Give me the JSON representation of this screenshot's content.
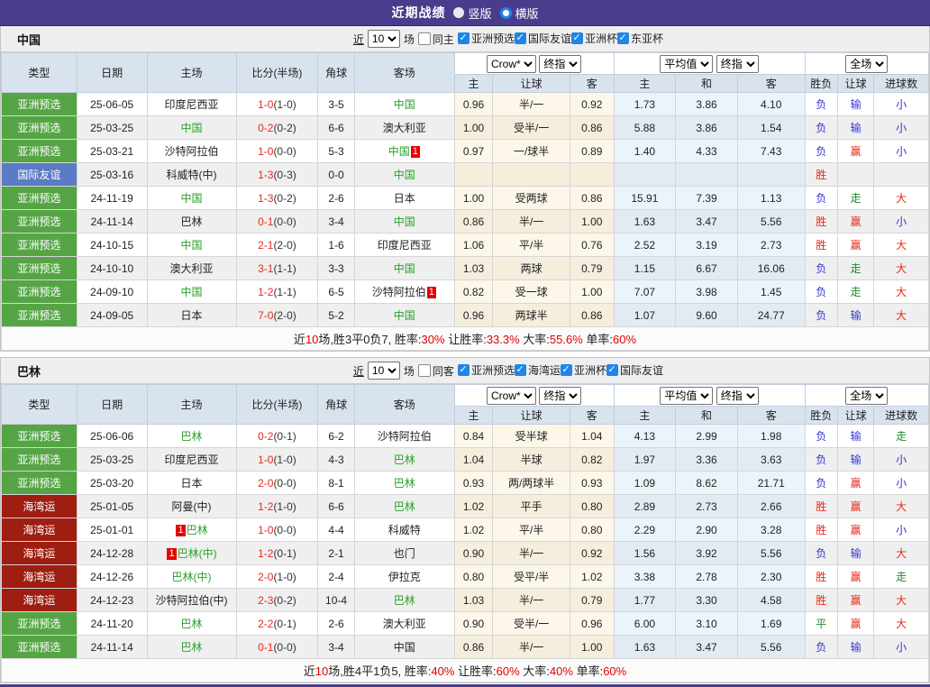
{
  "topbar": {
    "title": "近期战绩",
    "radio_vertical": "竖版",
    "radio_horizontal": "横版",
    "selected": "横版"
  },
  "colors": {
    "accent_purple": "#473d8c",
    "checkbox_blue": "#1f86e8",
    "type_badges": {
      "green": "#55a545",
      "blue": "#5a7bc5",
      "darkred": "#9e1e12"
    },
    "result_text": {
      "red": "#e8291c",
      "blue": "#3434d0",
      "green": "#1d8a2e"
    },
    "team_green": "#2ca12c",
    "score_red": "#e60000"
  },
  "filter": {
    "near": "近",
    "count": "10",
    "games": "场"
  },
  "header": {
    "type": "类型",
    "date": "日期",
    "home": "主场",
    "score": "比分(半场)",
    "corner": "角球",
    "away": "客场",
    "odds_dd1": "Crow*",
    "odds_dd2": "终指",
    "avg_dd1": "平均值",
    "avg_dd2": "终指",
    "full_dd": "全场",
    "odds_home": "主",
    "odds_handicap": "让球",
    "odds_away": "客",
    "avg_home": "主",
    "avg_draw": "和",
    "avg_away": "客",
    "result_wdl": "胜负",
    "result_handicap": "让球",
    "result_goals": "进球数"
  },
  "sections": [
    {
      "team": "中国",
      "same_label": "同主",
      "same_checked": false,
      "competitions": [
        {
          "label": "亚洲预选",
          "checked": true
        },
        {
          "label": "国际友谊",
          "checked": true
        },
        {
          "label": "亚洲杯",
          "checked": true
        },
        {
          "label": "东亚杯",
          "checked": true
        }
      ],
      "rows": [
        {
          "type": "亚洲预选",
          "type_color": "green",
          "date": "25-06-05",
          "home": {
            "name": "印度尼西亚",
            "green": false
          },
          "ft": "1-0",
          "ht": "(1-0)",
          "corner": "3-5",
          "away": {
            "name": "中国",
            "green": true
          },
          "odds": [
            "0.96",
            "半/一",
            "0.92"
          ],
          "avg": [
            "1.73",
            "3.86",
            "4.10"
          ],
          "res": [
            {
              "t": "负",
              "c": "blue"
            },
            {
              "t": "输",
              "c": "blue"
            },
            {
              "t": "小",
              "c": "blue"
            }
          ]
        },
        {
          "type": "亚洲预选",
          "type_color": "green",
          "date": "25-03-25",
          "home": {
            "name": "中国",
            "green": true
          },
          "ft": "0-2",
          "ht": "(0-2)",
          "corner": "6-6",
          "away": {
            "name": "澳大利亚",
            "green": false
          },
          "odds": [
            "1.00",
            "受半/一",
            "0.86"
          ],
          "avg": [
            "5.88",
            "3.86",
            "1.54"
          ],
          "res": [
            {
              "t": "负",
              "c": "blue"
            },
            {
              "t": "输",
              "c": "blue"
            },
            {
              "t": "小",
              "c": "blue"
            }
          ]
        },
        {
          "type": "亚洲预选",
          "type_color": "green",
          "date": "25-03-21",
          "home": {
            "name": "沙特阿拉伯",
            "green": false
          },
          "ft": "1-0",
          "ht": "(0-0)",
          "corner": "5-3",
          "away": {
            "name": "中国",
            "green": true,
            "badge": "1",
            "badge_pos": "after"
          },
          "odds": [
            "0.97",
            "一/球半",
            "0.89"
          ],
          "avg": [
            "1.40",
            "4.33",
            "7.43"
          ],
          "res": [
            {
              "t": "负",
              "c": "blue"
            },
            {
              "t": "赢",
              "c": "red"
            },
            {
              "t": "小",
              "c": "blue"
            }
          ]
        },
        {
          "type": "国际友谊",
          "type_color": "blue",
          "date": "25-03-16",
          "home": {
            "name": "科威特(中)",
            "green": false
          },
          "ft": "1-3",
          "ht": "(0-3)",
          "corner": "0-0",
          "away": {
            "name": "中国",
            "green": true
          },
          "odds": [
            "",
            "",
            ""
          ],
          "avg": [
            "",
            "",
            ""
          ],
          "res": [
            {
              "t": "胜",
              "c": "red"
            },
            {
              "t": "",
              "c": ""
            },
            {
              "t": "",
              "c": ""
            }
          ]
        },
        {
          "type": "亚洲预选",
          "type_color": "green",
          "date": "24-11-19",
          "home": {
            "name": "中国",
            "green": true
          },
          "ft": "1-3",
          "ht": "(0-2)",
          "corner": "2-6",
          "away": {
            "name": "日本",
            "green": false
          },
          "odds": [
            "1.00",
            "受两球",
            "0.86"
          ],
          "avg": [
            "15.91",
            "7.39",
            "1.13"
          ],
          "res": [
            {
              "t": "负",
              "c": "blue"
            },
            {
              "t": "走",
              "c": "green"
            },
            {
              "t": "大",
              "c": "red"
            }
          ]
        },
        {
          "type": "亚洲预选",
          "type_color": "green",
          "date": "24-11-14",
          "home": {
            "name": "巴林",
            "green": false
          },
          "ft": "0-1",
          "ht": "(0-0)",
          "corner": "3-4",
          "away": {
            "name": "中国",
            "green": true
          },
          "odds": [
            "0.86",
            "半/一",
            "1.00"
          ],
          "avg": [
            "1.63",
            "3.47",
            "5.56"
          ],
          "res": [
            {
              "t": "胜",
              "c": "red"
            },
            {
              "t": "赢",
              "c": "red"
            },
            {
              "t": "小",
              "c": "blue"
            }
          ]
        },
        {
          "type": "亚洲预选",
          "type_color": "green",
          "date": "24-10-15",
          "home": {
            "name": "中国",
            "green": true
          },
          "ft": "2-1",
          "ht": "(2-0)",
          "corner": "1-6",
          "away": {
            "name": "印度尼西亚",
            "green": false
          },
          "odds": [
            "1.06",
            "平/半",
            "0.76"
          ],
          "avg": [
            "2.52",
            "3.19",
            "2.73"
          ],
          "res": [
            {
              "t": "胜",
              "c": "red"
            },
            {
              "t": "赢",
              "c": "red"
            },
            {
              "t": "大",
              "c": "red"
            }
          ]
        },
        {
          "type": "亚洲预选",
          "type_color": "green",
          "date": "24-10-10",
          "home": {
            "name": "澳大利亚",
            "green": false
          },
          "ft": "3-1",
          "ht": "(1-1)",
          "corner": "3-3",
          "away": {
            "name": "中国",
            "green": true
          },
          "odds": [
            "1.03",
            "两球",
            "0.79"
          ],
          "avg": [
            "1.15",
            "6.67",
            "16.06"
          ],
          "res": [
            {
              "t": "负",
              "c": "blue"
            },
            {
              "t": "走",
              "c": "green"
            },
            {
              "t": "大",
              "c": "red"
            }
          ]
        },
        {
          "type": "亚洲预选",
          "type_color": "green",
          "date": "24-09-10",
          "home": {
            "name": "中国",
            "green": true
          },
          "ft": "1-2",
          "ht": "(1-1)",
          "corner": "6-5",
          "away": {
            "name": "沙特阿拉伯",
            "green": false,
            "badge": "1",
            "badge_pos": "after"
          },
          "odds": [
            "0.82",
            "受一球",
            "1.00"
          ],
          "avg": [
            "7.07",
            "3.98",
            "1.45"
          ],
          "res": [
            {
              "t": "负",
              "c": "blue"
            },
            {
              "t": "走",
              "c": "green"
            },
            {
              "t": "大",
              "c": "red"
            }
          ]
        },
        {
          "type": "亚洲预选",
          "type_color": "green",
          "date": "24-09-05",
          "home": {
            "name": "日本",
            "green": false
          },
          "ft": "7-0",
          "ht": "(2-0)",
          "corner": "5-2",
          "away": {
            "name": "中国",
            "green": true
          },
          "odds": [
            "0.96",
            "两球半",
            "0.86"
          ],
          "avg": [
            "1.07",
            "9.60",
            "24.77"
          ],
          "res": [
            {
              "t": "负",
              "c": "blue"
            },
            {
              "t": "输",
              "c": "blue"
            },
            {
              "t": "大",
              "c": "red"
            }
          ]
        }
      ],
      "summary": [
        {
          "t": "近",
          "red": false
        },
        {
          "t": "10",
          "red": true
        },
        {
          "t": "场,胜3平0负7, 胜率:",
          "red": false
        },
        {
          "t": "30%",
          "red": true
        },
        {
          "t": " 让胜率:",
          "red": false
        },
        {
          "t": "33.3%",
          "red": true
        },
        {
          "t": " 大率:",
          "red": false
        },
        {
          "t": "55.6%",
          "red": true
        },
        {
          "t": " 单率:",
          "red": false
        },
        {
          "t": "60%",
          "red": true
        }
      ]
    },
    {
      "team": "巴林",
      "same_label": "同客",
      "same_checked": false,
      "competitions": [
        {
          "label": "亚洲预选",
          "checked": true
        },
        {
          "label": "海湾运",
          "checked": true
        },
        {
          "label": "亚洲杯",
          "checked": true
        },
        {
          "label": "国际友谊",
          "checked": true
        }
      ],
      "rows": [
        {
          "type": "亚洲预选",
          "type_color": "green",
          "date": "25-06-06",
          "home": {
            "name": "巴林",
            "green": true
          },
          "ft": "0-2",
          "ht": "(0-1)",
          "corner": "6-2",
          "away": {
            "name": "沙特阿拉伯",
            "green": false
          },
          "odds": [
            "0.84",
            "受半球",
            "1.04"
          ],
          "avg": [
            "4.13",
            "2.99",
            "1.98"
          ],
          "res": [
            {
              "t": "负",
              "c": "blue"
            },
            {
              "t": "输",
              "c": "blue"
            },
            {
              "t": "走",
              "c": "green"
            }
          ]
        },
        {
          "type": "亚洲预选",
          "type_color": "green",
          "date": "25-03-25",
          "home": {
            "name": "印度尼西亚",
            "green": false
          },
          "ft": "1-0",
          "ht": "(1-0)",
          "corner": "4-3",
          "away": {
            "name": "巴林",
            "green": true
          },
          "odds": [
            "1.04",
            "半球",
            "0.82"
          ],
          "avg": [
            "1.97",
            "3.36",
            "3.63"
          ],
          "res": [
            {
              "t": "负",
              "c": "blue"
            },
            {
              "t": "输",
              "c": "blue"
            },
            {
              "t": "小",
              "c": "blue"
            }
          ]
        },
        {
          "type": "亚洲预选",
          "type_color": "green",
          "date": "25-03-20",
          "home": {
            "name": "日本",
            "green": false
          },
          "ft": "2-0",
          "ht": "(0-0)",
          "corner": "8-1",
          "away": {
            "name": "巴林",
            "green": true
          },
          "odds": [
            "0.93",
            "两/两球半",
            "0.93"
          ],
          "avg": [
            "1.09",
            "8.62",
            "21.71"
          ],
          "res": [
            {
              "t": "负",
              "c": "blue"
            },
            {
              "t": "赢",
              "c": "red"
            },
            {
              "t": "小",
              "c": "blue"
            }
          ]
        },
        {
          "type": "海湾运",
          "type_color": "darkred",
          "date": "25-01-05",
          "home": {
            "name": "阿曼(中)",
            "green": false
          },
          "ft": "1-2",
          "ht": "(1-0)",
          "corner": "6-6",
          "away": {
            "name": "巴林",
            "green": true
          },
          "odds": [
            "1.02",
            "平手",
            "0.80"
          ],
          "avg": [
            "2.89",
            "2.73",
            "2.66"
          ],
          "res": [
            {
              "t": "胜",
              "c": "red"
            },
            {
              "t": "赢",
              "c": "red"
            },
            {
              "t": "大",
              "c": "red"
            }
          ]
        },
        {
          "type": "海湾运",
          "type_color": "darkred",
          "date": "25-01-01",
          "home": {
            "name": "巴林",
            "green": true,
            "badge": "1",
            "badge_pos": "before"
          },
          "ft": "1-0",
          "ht": "(0-0)",
          "corner": "4-4",
          "away": {
            "name": "科威特",
            "green": false
          },
          "odds": [
            "1.02",
            "平/半",
            "0.80"
          ],
          "avg": [
            "2.29",
            "2.90",
            "3.28"
          ],
          "res": [
            {
              "t": "胜",
              "c": "red"
            },
            {
              "t": "赢",
              "c": "red"
            },
            {
              "t": "小",
              "c": "blue"
            }
          ]
        },
        {
          "type": "海湾运",
          "type_color": "darkred",
          "date": "24-12-28",
          "home": {
            "name": "巴林(中)",
            "green": true,
            "badge": "1",
            "badge_pos": "before"
          },
          "ft": "1-2",
          "ht": "(0-1)",
          "corner": "2-1",
          "away": {
            "name": "也门",
            "green": false
          },
          "odds": [
            "0.90",
            "半/一",
            "0.92"
          ],
          "avg": [
            "1.56",
            "3.92",
            "5.56"
          ],
          "res": [
            {
              "t": "负",
              "c": "blue"
            },
            {
              "t": "输",
              "c": "blue"
            },
            {
              "t": "大",
              "c": "red"
            }
          ]
        },
        {
          "type": "海湾运",
          "type_color": "darkred",
          "date": "24-12-26",
          "home": {
            "name": "巴林(中)",
            "green": true
          },
          "ft": "2-0",
          "ht": "(1-0)",
          "corner": "2-4",
          "away": {
            "name": "伊拉克",
            "green": false
          },
          "odds": [
            "0.80",
            "受平/半",
            "1.02"
          ],
          "avg": [
            "3.38",
            "2.78",
            "2.30"
          ],
          "res": [
            {
              "t": "胜",
              "c": "red"
            },
            {
              "t": "赢",
              "c": "red"
            },
            {
              "t": "走",
              "c": "green"
            }
          ]
        },
        {
          "type": "海湾运",
          "type_color": "darkred",
          "date": "24-12-23",
          "home": {
            "name": "沙特阿拉伯(中)",
            "green": false
          },
          "ft": "2-3",
          "ht": "(0-2)",
          "corner": "10-4",
          "away": {
            "name": "巴林",
            "green": true
          },
          "odds": [
            "1.03",
            "半/一",
            "0.79"
          ],
          "avg": [
            "1.77",
            "3.30",
            "4.58"
          ],
          "res": [
            {
              "t": "胜",
              "c": "red"
            },
            {
              "t": "赢",
              "c": "red"
            },
            {
              "t": "大",
              "c": "red"
            }
          ]
        },
        {
          "type": "亚洲预选",
          "type_color": "green",
          "date": "24-11-20",
          "home": {
            "name": "巴林",
            "green": true
          },
          "ft": "2-2",
          "ht": "(0-1)",
          "corner": "2-6",
          "away": {
            "name": "澳大利亚",
            "green": false
          },
          "odds": [
            "0.90",
            "受半/一",
            "0.96"
          ],
          "avg": [
            "6.00",
            "3.10",
            "1.69"
          ],
          "res": [
            {
              "t": "平",
              "c": "green"
            },
            {
              "t": "赢",
              "c": "red"
            },
            {
              "t": "大",
              "c": "red"
            }
          ]
        },
        {
          "type": "亚洲预选",
          "type_color": "green",
          "date": "24-11-14",
          "home": {
            "name": "巴林",
            "green": true
          },
          "ft": "0-1",
          "ht": "(0-0)",
          "corner": "3-4",
          "away": {
            "name": "中国",
            "green": false
          },
          "odds": [
            "0.86",
            "半/一",
            "1.00"
          ],
          "avg": [
            "1.63",
            "3.47",
            "5.56"
          ],
          "res": [
            {
              "t": "负",
              "c": "blue"
            },
            {
              "t": "输",
              "c": "blue"
            },
            {
              "t": "小",
              "c": "blue"
            }
          ]
        }
      ],
      "summary": [
        {
          "t": "近",
          "red": false
        },
        {
          "t": "10",
          "red": true
        },
        {
          "t": "场,胜4平1负5, 胜率:",
          "red": false
        },
        {
          "t": "40%",
          "red": true
        },
        {
          "t": " 让胜率:",
          "red": false
        },
        {
          "t": "60%",
          "red": true
        },
        {
          "t": " 大率:",
          "red": false
        },
        {
          "t": "40%",
          "red": true
        },
        {
          "t": " 单率:",
          "red": false
        },
        {
          "t": "60%",
          "red": true
        }
      ]
    }
  ]
}
